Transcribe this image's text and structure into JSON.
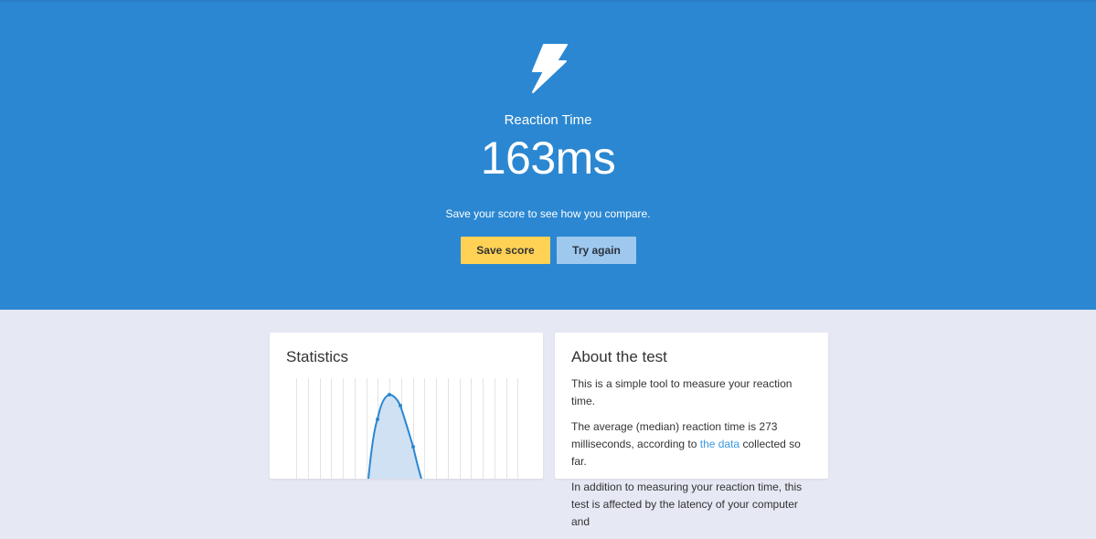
{
  "hero": {
    "icon": "lightning-bolt-icon",
    "title": "Reaction Time",
    "score": "163ms",
    "subtitle": "Save your score to see how you compare.",
    "save_label": "Save score",
    "try_label": "Try again"
  },
  "colors": {
    "hero_bg": "#2b87d1",
    "page_bg": "#e6e8f4",
    "save_btn": "#ffd154",
    "try_btn": "#9fc8ee",
    "link": "#3a9ae2",
    "chart_line": "#2b87d1"
  },
  "stats": {
    "title": "Statistics"
  },
  "about": {
    "title": "About the test",
    "p1": "This is a simple tool to measure your reaction time.",
    "p2_before": "The average (median) reaction time is 273 milliseconds, according to ",
    "p2_link": "the data",
    "p2_after": " collected so far.",
    "p3": "In addition to measuring your reaction time, this test is affected by the latency of your computer and"
  }
}
